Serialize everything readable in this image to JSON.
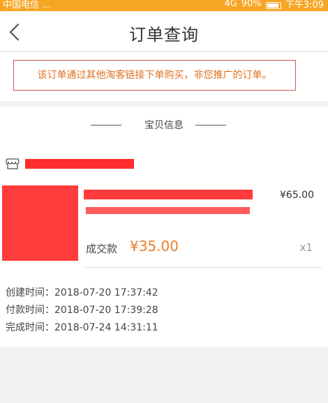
{
  "status_bar": {
    "carrier": "中国电信 …",
    "signal": "4G",
    "battery": "90%",
    "time": "下午3:09"
  },
  "header": {
    "title": "订单查询",
    "back_icon": "chevron-left-icon"
  },
  "notice": {
    "text": "该订单通过其他淘客链接下单购买，非您推广的订单。",
    "border_color": "#d9534f",
    "text_color": "#e07021"
  },
  "item_section": {
    "title": "宝贝信息",
    "shop_icon": "store-icon",
    "product": {
      "unit_price": "¥65.00",
      "deal_label": "成交款",
      "deal_price": "¥35.00",
      "quantity": "x1"
    }
  },
  "times": [
    {
      "label": "创建时间：",
      "value": "2018-07-20 17:37:42"
    },
    {
      "label": "付款时间：",
      "value": "2018-07-20 17:39:28"
    },
    {
      "label": "完成时间：",
      "value": "2018-07-24 14:31:11"
    }
  ],
  "colors": {
    "status_bar": "#f7a623",
    "accent_price": "#e9802a",
    "redaction": "#ff3b3b"
  }
}
